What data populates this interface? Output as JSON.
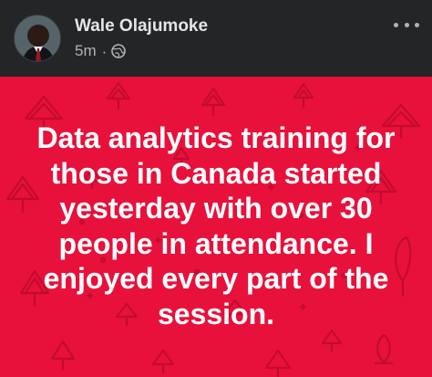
{
  "post": {
    "author": "Wale Olajumoke",
    "time": "5m",
    "separator": "·",
    "privacy_icon": "globe-icon",
    "more_icon": "more-options-icon",
    "body_text": "Data analytics training for those in Canada started yesterday with over 30 people in attendance. I enjoyed every part of the session.",
    "background_color": "#e8113b",
    "background_pattern": "christmas-tree-pattern"
  },
  "colors": {
    "header_bg": "#242526",
    "author_text": "#e4e6eb",
    "meta_text": "#b0b3b8",
    "post_text": "#ffffff"
  }
}
